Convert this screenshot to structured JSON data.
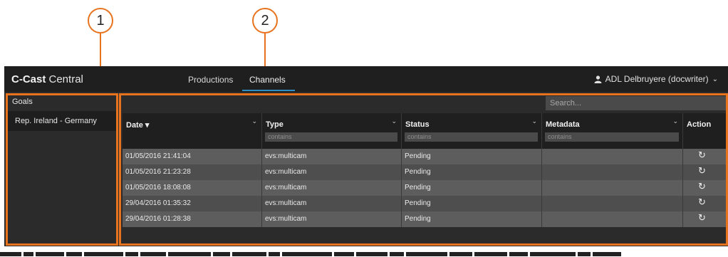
{
  "callouts": [
    "1",
    "2"
  ],
  "app": {
    "logo_prefix": "C-Cast",
    "logo_suffix": " Central",
    "nav": [
      {
        "label": "Productions"
      },
      {
        "label": "Channels",
        "active": true
      }
    ],
    "user": {
      "name": "ADL Delbruyere (docwriter)",
      "icon": "user-icon",
      "chevron": "chevron-down-icon"
    }
  },
  "left_panel": {
    "title": "Goals",
    "items": [
      "Rep. Ireland - Germany"
    ]
  },
  "grid": {
    "search_placeholder": "Search...",
    "columns": [
      {
        "label": "Date",
        "sort": "▾",
        "filter": ""
      },
      {
        "label": "Type",
        "filter": "contains"
      },
      {
        "label": "Status",
        "filter": "contains"
      },
      {
        "label": "Metadata",
        "filter": "contains"
      },
      {
        "label": "Action"
      }
    ],
    "rows": [
      {
        "date": "01/05/2016 21:41:04",
        "type": "evs:multicam",
        "status": "Pending",
        "metadata": ""
      },
      {
        "date": "01/05/2016 21:23:28",
        "type": "evs:multicam",
        "status": "Pending",
        "metadata": ""
      },
      {
        "date": "01/05/2016 18:08:08",
        "type": "evs:multicam",
        "status": "Pending",
        "metadata": ""
      },
      {
        "date": "29/04/2016 01:35:32",
        "type": "evs:multicam",
        "status": "Pending",
        "metadata": ""
      },
      {
        "date": "29/04/2016 01:28:38",
        "type": "evs:multicam",
        "status": "Pending",
        "metadata": ""
      }
    ]
  },
  "colors": {
    "highlight": "#e8731f",
    "accent": "#2e8fc7",
    "row_even": "#5d5d5d",
    "row_odd": "#4e4e4e"
  }
}
